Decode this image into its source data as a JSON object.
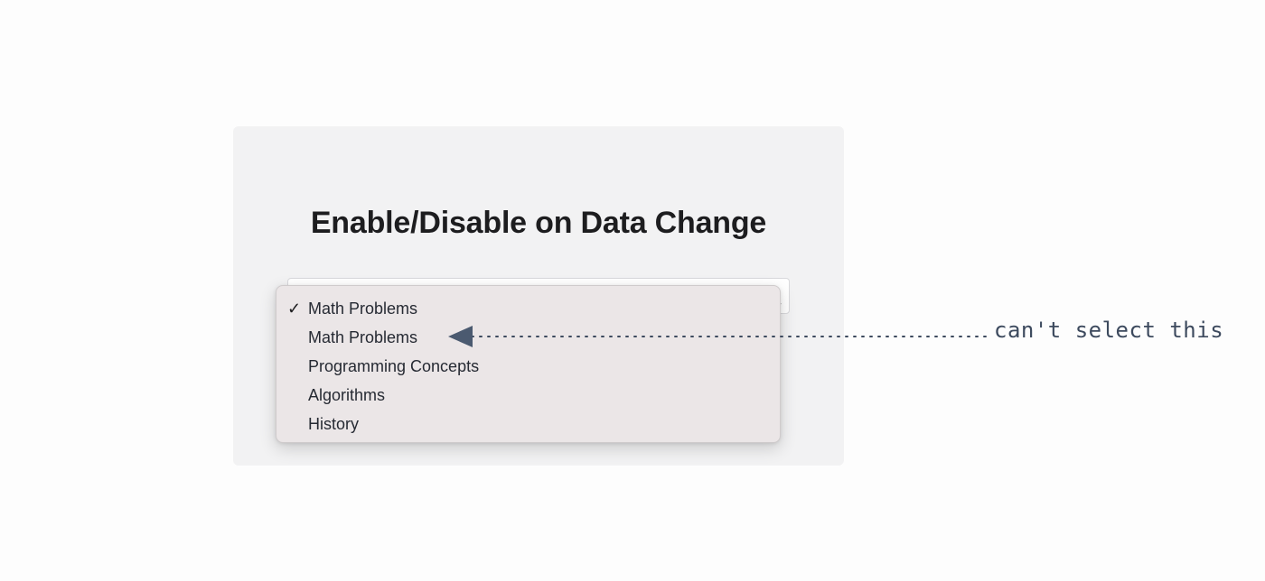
{
  "heading": "Enable/Disable on Data Change",
  "select": {
    "selected_value": "Math Problems",
    "options": [
      {
        "label": "Math Problems",
        "checked": true,
        "disabled": false
      },
      {
        "label": "Math Problems",
        "checked": false,
        "disabled": true
      },
      {
        "label": "Programming Concepts",
        "checked": false,
        "disabled": false
      },
      {
        "label": "Algorithms",
        "checked": false,
        "disabled": false
      },
      {
        "label": "History",
        "checked": false,
        "disabled": false
      }
    ]
  },
  "annotation": {
    "text": "can't select this",
    "color": "#3d4a5e"
  },
  "icons": {
    "check": "checkmark-icon",
    "chevron": "chevron-down-icon",
    "arrow": "arrow-left-icon"
  }
}
